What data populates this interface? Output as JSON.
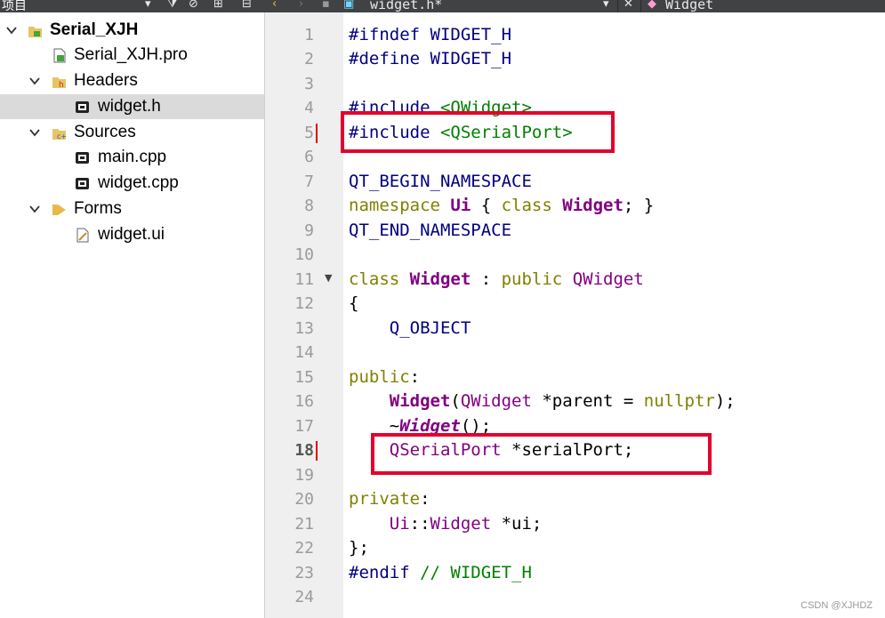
{
  "project_panel": {
    "title": "项目",
    "tree": [
      {
        "label": "Serial_XJH",
        "bold": true,
        "expanded": true,
        "icon": "project-icon"
      },
      {
        "label": "Serial_XJH.pro",
        "icon": "pro-file-icon"
      },
      {
        "label": "Headers",
        "expanded": true,
        "icon": "headers-folder-icon"
      },
      {
        "label": "widget.h",
        "selected": true,
        "icon": "header-file-icon"
      },
      {
        "label": "Sources",
        "expanded": true,
        "icon": "sources-folder-icon"
      },
      {
        "label": "main.cpp",
        "icon": "cpp-file-icon"
      },
      {
        "label": "widget.cpp",
        "icon": "cpp-file-icon"
      },
      {
        "label": "Forms",
        "expanded": true,
        "icon": "forms-folder-icon"
      },
      {
        "label": "widget.ui",
        "icon": "ui-file-icon"
      }
    ]
  },
  "editor_toolbar": {
    "file_tab": "widget.h*",
    "symbol": "Widget"
  },
  "editor": {
    "current_line": 18,
    "line_numbers": [
      "1",
      "2",
      "3",
      "4",
      "5",
      "6",
      "7",
      "8",
      "9",
      "10",
      "11",
      "12",
      "13",
      "14",
      "15",
      "16",
      "17",
      "18",
      "19",
      "20",
      "21",
      "22",
      "23",
      "24"
    ],
    "code": {
      "l1_a": "#ifndef",
      "l1_b": " WIDGET_H",
      "l2_a": "#define",
      "l2_b": " WIDGET_H",
      "l4_a": "#include",
      "l4_b": " <QWidget>",
      "l5_a": "#include",
      "l5_b": " <QSerialPort>",
      "l7": "QT_BEGIN_NAMESPACE",
      "l8_a": "namespace",
      "l8_b": " Ui",
      "l8_c": " {",
      "l8_d": " class",
      "l8_e": " Widget",
      "l8_f": "; }",
      "l9": "QT_END_NAMESPACE",
      "l11_a": "class",
      "l11_b": " Widget",
      "l11_c": " :",
      "l11_d": " public",
      "l11_e": " QWidget",
      "l12": "{",
      "l13": "    Q_OBJECT",
      "l15_a": "public",
      "l15_b": ":",
      "l16_a": "    Widget",
      "l16_b": "(",
      "l16_c": "QWidget",
      "l16_d": " *parent = ",
      "l16_e": "nullptr",
      "l16_f": ");",
      "l17_a": "    ~",
      "l17_b": "Widget",
      "l17_c": "();",
      "l18_a": "    QSerialPort",
      "l18_b": " *serialPort;",
      "l20_a": "private",
      "l20_b": ":",
      "l21_a": "    Ui",
      "l21_b": "::",
      "l21_c": "Widget",
      "l21_d": " *ui;",
      "l22": "};",
      "l23_a": "#endif",
      "l23_b": " // WIDGET_H"
    }
  },
  "watermark": "CSDN @XJHDZ"
}
